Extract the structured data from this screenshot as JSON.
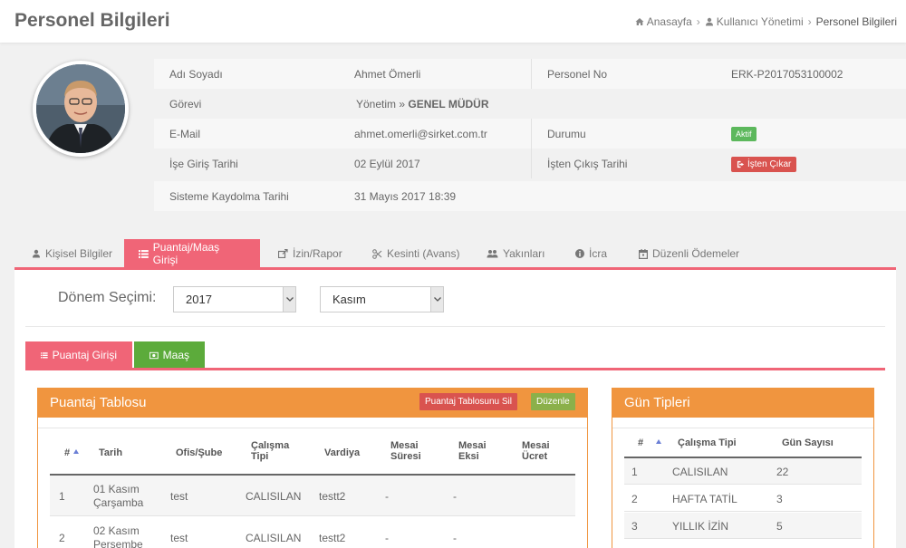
{
  "header": {
    "title": "Personel Bilgileri",
    "breadcrumb": [
      "Anasayfa",
      "Kullanıcı Yönetimi",
      "Personel Bilgileri"
    ]
  },
  "profile": {
    "name_label": "Adı Soyadı",
    "name_value": "Ahmet Ömerli",
    "personel_no_label": "Personel No",
    "personel_no_value": "ERK-P2017053100002",
    "gorev_label": "Görevi",
    "gorev_prefix": "Yönetim »",
    "gorev_value": "GENEL MÜDÜR",
    "email_label": "E-Mail",
    "email_value": "ahmet.omerli@sirket.com.tr",
    "durum_label": "Durumu",
    "durum_value": "Aktif",
    "giris_label": "İşe Giriş Tarihi",
    "giris_value": "02 Eylül 2017",
    "cikis_label": "İşten Çıkış Tarihi",
    "cikis_button": "İşten Çıkar",
    "kayit_label": "Sisteme Kaydolma Tarihi",
    "kayit_value": "31 Mayıs 2017 18:39"
  },
  "tabs": [
    {
      "label": "Kişisel Bilgiler",
      "icon": "user-icon"
    },
    {
      "label": "Puantaj/Maaş Girişi",
      "icon": "list-icon",
      "active": true
    },
    {
      "label": "İzin/Rapor",
      "icon": "share-icon"
    },
    {
      "label": "Kesinti (Avans)",
      "icon": "scissors-icon"
    },
    {
      "label": "Yakınları",
      "icon": "users-icon"
    },
    {
      "label": "İcra",
      "icon": "info-icon"
    },
    {
      "label": "Düzenli Ödemeler",
      "icon": "calendar-icon"
    }
  ],
  "donem": {
    "label": "Dönem Seçimi:",
    "year": "2017",
    "month": "Kasım"
  },
  "subtabs": [
    {
      "label": "Puantaj Girişi",
      "icon": "list-icon",
      "color": "#f06577"
    },
    {
      "label": "Maaş",
      "icon": "money-icon",
      "color": "#5cab3b"
    }
  ],
  "puantaj": {
    "title": "Puantaj Tablosu",
    "delete_button": "Puantaj Tablosunu Sil",
    "edit_button": "Düzenle",
    "columns": [
      "#",
      "Tarih",
      "Ofis/Şube",
      "Çalışma Tipi",
      "Vardiya",
      "Mesai Süresi",
      "Mesai Eksi",
      "Mesai Ücret"
    ],
    "rows": [
      [
        "1",
        "01 Kasım Çarşamba",
        "test",
        "CALISILAN",
        "testt2",
        "-",
        "-",
        ""
      ],
      [
        "2",
        "02 Kasım Perşembe",
        "test",
        "CALISILAN",
        "testt2",
        "-",
        "-",
        ""
      ]
    ]
  },
  "gun_tipleri": {
    "title": "Gün Tipleri",
    "columns": [
      "#",
      "Çalışma Tipi",
      "Gün Sayısı"
    ],
    "rows": [
      [
        "1",
        "CALISILAN",
        "22"
      ],
      [
        "2",
        "HAFTA TATİL",
        "3"
      ],
      [
        "3",
        "YILLIK İZİN",
        "5"
      ]
    ]
  },
  "colors": {
    "accent": "#f06577",
    "orange": "#f0953f",
    "green": "#5cab3b",
    "danger": "#d9534f",
    "success": "#5cb85c"
  }
}
